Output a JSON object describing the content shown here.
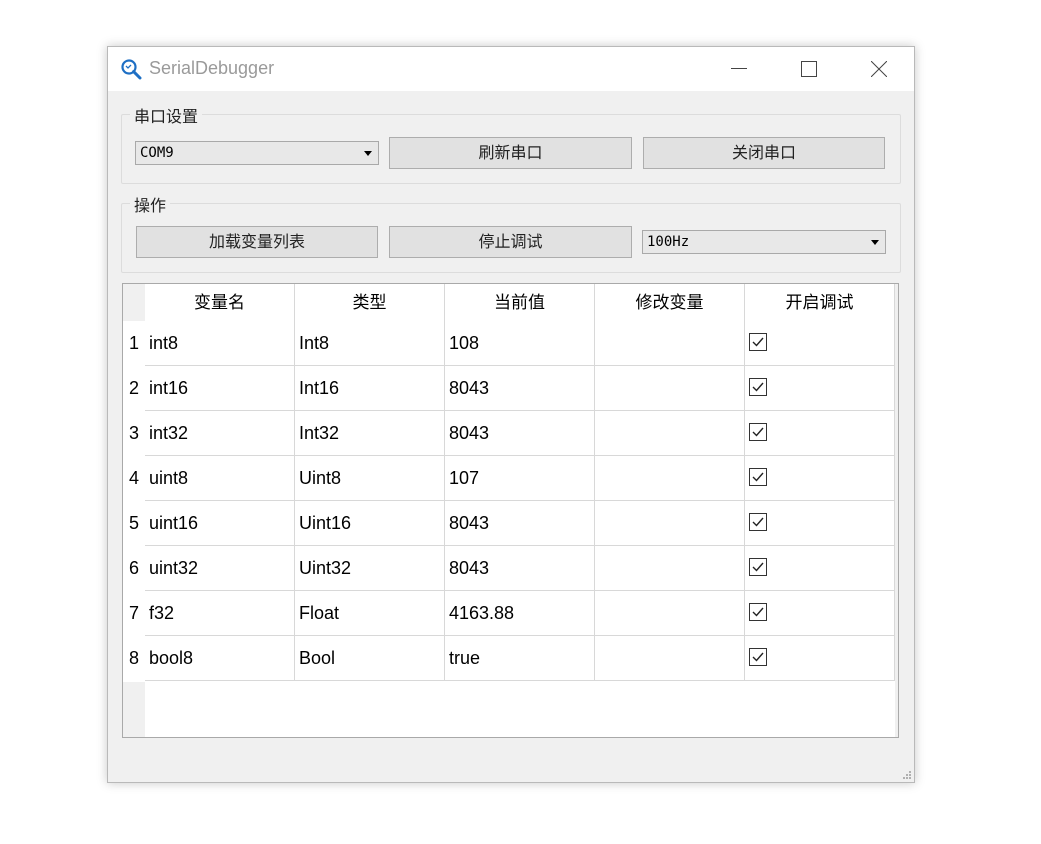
{
  "window": {
    "title": "SerialDebugger"
  },
  "serial_group": {
    "title": "串口设置",
    "port": "COM9",
    "refresh_label": "刷新串口",
    "close_label": "关闭串口"
  },
  "ops_group": {
    "title": "操作",
    "load_label": "加载变量列表",
    "stop_label": "停止调试",
    "rate": "100Hz"
  },
  "table": {
    "columns": [
      "变量名",
      "类型",
      "当前值",
      "修改变量",
      "开启调试"
    ],
    "rows": [
      {
        "index": "1",
        "name": "int8",
        "type": "Int8",
        "value": "108",
        "modify": "",
        "debug": true
      },
      {
        "index": "2",
        "name": "int16",
        "type": "Int16",
        "value": "8043",
        "modify": "",
        "debug": true
      },
      {
        "index": "3",
        "name": "int32",
        "type": "Int32",
        "value": "8043",
        "modify": "",
        "debug": true
      },
      {
        "index": "4",
        "name": "uint8",
        "type": "Uint8",
        "value": "107",
        "modify": "",
        "debug": true
      },
      {
        "index": "5",
        "name": "uint16",
        "type": "Uint16",
        "value": "8043",
        "modify": "",
        "debug": true
      },
      {
        "index": "6",
        "name": "uint32",
        "type": "Uint32",
        "value": "8043",
        "modify": "",
        "debug": true
      },
      {
        "index": "7",
        "name": "f32",
        "type": "Float",
        "value": "4163.88",
        "modify": "",
        "debug": true
      },
      {
        "index": "8",
        "name": "bool8",
        "type": "Bool",
        "value": "true",
        "modify": "",
        "debug": true
      }
    ]
  },
  "icons": {
    "app": "magnifier-icon",
    "minimize": "minimize-icon",
    "maximize": "maximize-icon",
    "close": "close-icon",
    "dropdown": "dropdown-arrow-icon",
    "check": "checkmark-icon"
  },
  "colors": {
    "accent": "#1e6fc4",
    "window_bg": "#f0f0f0"
  }
}
